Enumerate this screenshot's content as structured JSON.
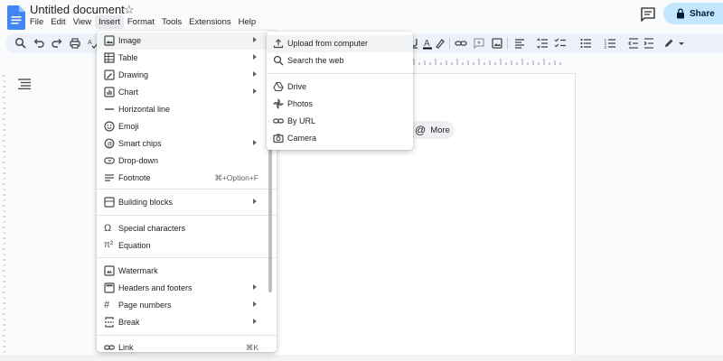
{
  "app": {
    "doc_title": "Untitled document",
    "share_label": "Share"
  },
  "menubar": [
    "File",
    "Edit",
    "View",
    "Insert",
    "Format",
    "Tools",
    "Extensions",
    "Help"
  ],
  "insert_menu": {
    "items": [
      {
        "label": "Image",
        "icon": "image-icon",
        "submenu": true
      },
      {
        "label": "Table",
        "icon": "table-icon",
        "submenu": true
      },
      {
        "label": "Drawing",
        "icon": "drawing-icon",
        "submenu": true
      },
      {
        "label": "Chart",
        "icon": "chart-icon",
        "submenu": true
      },
      {
        "label": "Horizontal line",
        "icon": "horizontal-line-icon",
        "submenu": false
      },
      {
        "label": "Emoji",
        "icon": "emoji-icon",
        "submenu": false
      },
      {
        "label": "Smart chips",
        "icon": "smart-chips-icon",
        "submenu": true
      },
      {
        "label": "Drop-down",
        "icon": "dropdown-icon",
        "submenu": false
      },
      {
        "label": "Footnote",
        "icon": "footnote-icon",
        "submenu": false,
        "shortcut": "⌘+Option+F"
      },
      {
        "label": "Building blocks",
        "icon": "building-blocks-icon",
        "submenu": true
      },
      {
        "label": "Special characters",
        "icon": "omega-icon",
        "submenu": false
      },
      {
        "label": "Equation",
        "icon": "equation-icon",
        "submenu": false
      },
      {
        "label": "Watermark",
        "icon": "watermark-icon",
        "submenu": false
      },
      {
        "label": "Headers and footers",
        "icon": "headers-footers-icon",
        "submenu": true
      },
      {
        "label": "Page numbers",
        "icon": "hash-icon",
        "submenu": true
      },
      {
        "label": "Break",
        "icon": "break-icon",
        "submenu": true
      },
      {
        "label": "Link",
        "icon": "link-icon",
        "submenu": false,
        "shortcut": "⌘K"
      }
    ]
  },
  "image_submenu": {
    "items": [
      {
        "label": "Upload from computer",
        "icon": "upload-icon"
      },
      {
        "label": "Search the web",
        "icon": "search-icon"
      },
      {
        "label": "Drive",
        "icon": "drive-icon"
      },
      {
        "label": "Photos",
        "icon": "photos-icon"
      },
      {
        "label": "By URL",
        "icon": "link-icon"
      },
      {
        "label": "Camera",
        "icon": "camera-icon"
      }
    ]
  },
  "chip": {
    "label": "More",
    "icon": "at-icon"
  },
  "colors": {
    "accent": "#c2e7ff",
    "toolbar_bg": "#edf2fa",
    "doc_blue": "#4285f4"
  }
}
